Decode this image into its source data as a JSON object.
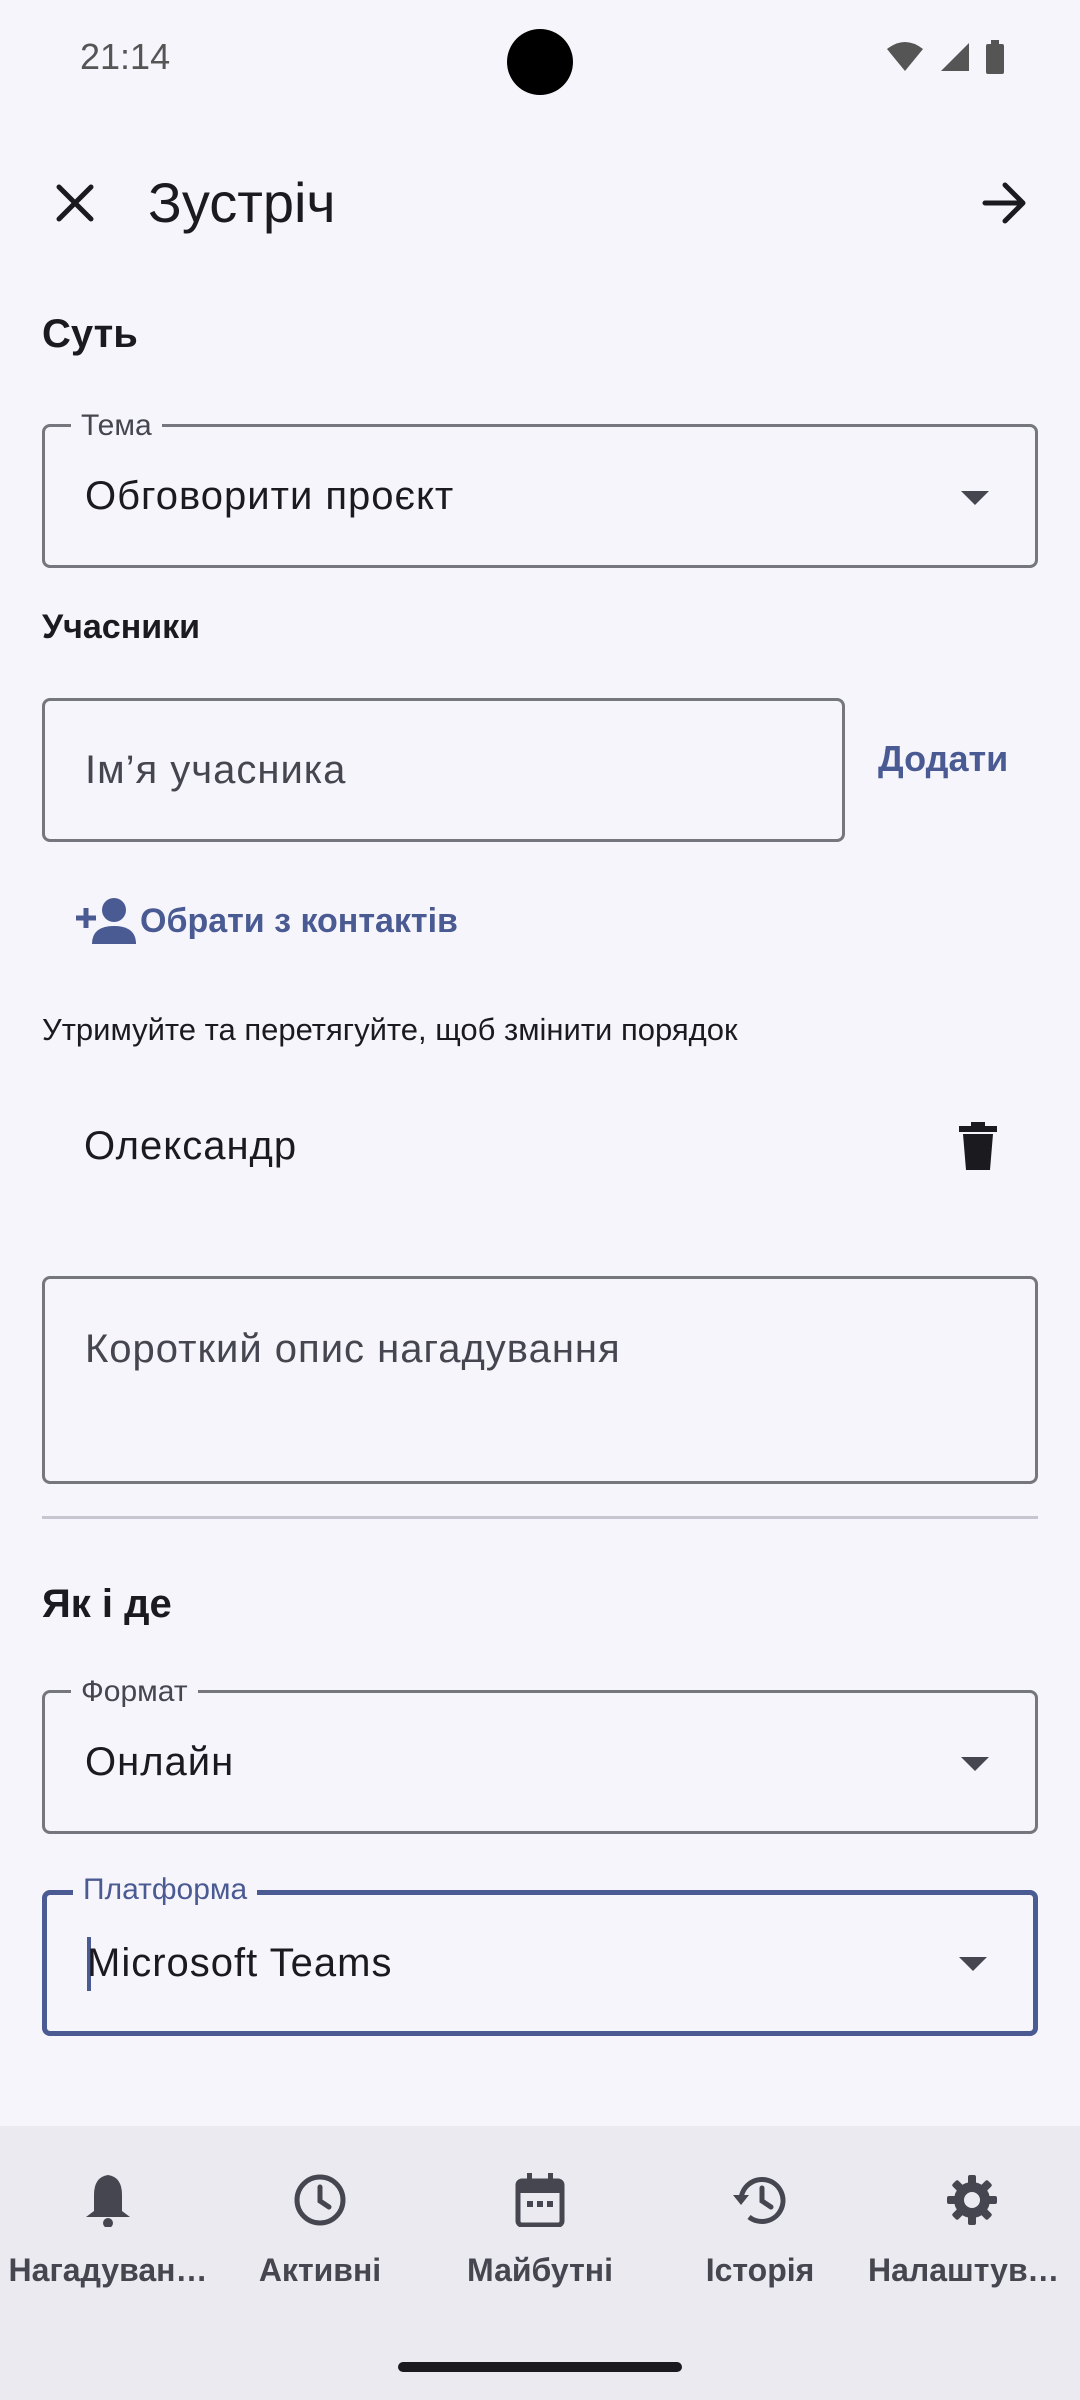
{
  "status": {
    "time": "21:14"
  },
  "topbar": {
    "title": "Зустріч"
  },
  "section_essence": {
    "title": "Суть",
    "topic_label": "Тема",
    "topic_value": "Обговорити проєкт"
  },
  "participants": {
    "title": "Учасники",
    "name_placeholder": "Ім’я учасника",
    "add_label": "Додати",
    "contacts_label": "Обрати з контактів",
    "reorder_hint": "Утримуйте та перетягуйте, щоб змінити порядок",
    "items": [
      {
        "name": "Олександр"
      }
    ]
  },
  "description": {
    "placeholder": "Короткий опис нагадування"
  },
  "section_how": {
    "title": "Як і де",
    "format_label": "Формат",
    "format_value": "Онлайн",
    "platform_label": "Платформа",
    "platform_value": "Microsoft Teams"
  },
  "bottom_nav": {
    "items": [
      {
        "label": "Нагадуван…",
        "icon": "bell-icon"
      },
      {
        "label": "Активні",
        "icon": "clock-icon"
      },
      {
        "label": "Майбутні",
        "icon": "calendar-icon"
      },
      {
        "label": "Історія",
        "icon": "history-icon"
      },
      {
        "label": "Налаштува…",
        "icon": "gear-icon"
      }
    ]
  },
  "colors": {
    "accent": "#4a5a92",
    "background": "#f6f5fb",
    "nav_background": "#ebeaf1"
  }
}
